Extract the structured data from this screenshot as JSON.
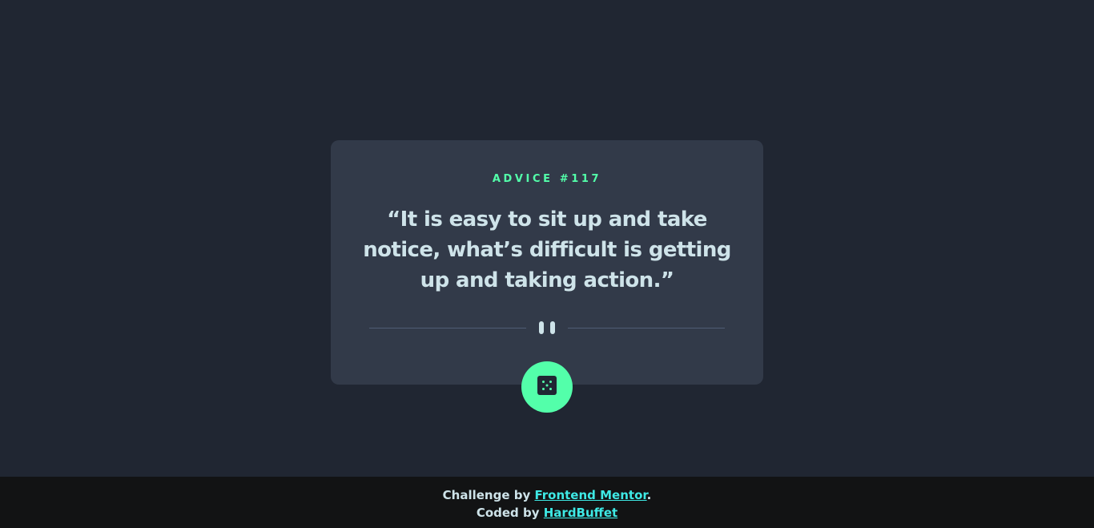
{
  "card": {
    "advice_label": "ADVICE #117",
    "quote": "“It is easy to sit up and take notice, what’s difficult is getting up and taking action.”"
  },
  "dice_button": {
    "icon": "dice-icon"
  },
  "divider": {
    "icon": "pause-icon"
  },
  "footer": {
    "challenge_prefix": "Challenge by ",
    "challenge_link": "Frontend Mentor",
    "challenge_suffix": ".",
    "coded_prefix": "Coded by ",
    "coded_link": "HardBuffet"
  },
  "colors": {
    "background": "#202632",
    "card": "#323A49",
    "accent": "#53FFAA",
    "text": "#CEE3E9",
    "divider": "#4F5D74",
    "link": "#3EE9E5",
    "footer_bg": "#121314"
  }
}
